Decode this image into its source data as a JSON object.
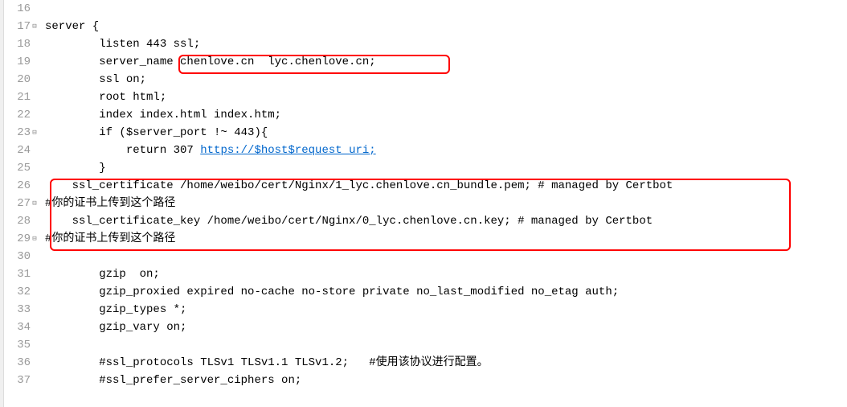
{
  "lines": [
    {
      "num": "16",
      "fold": "",
      "text": " "
    },
    {
      "num": "17",
      "fold": "⊟",
      "text": "server {"
    },
    {
      "num": "18",
      "fold": "",
      "text": "        listen 443 ssl;"
    },
    {
      "num": "19",
      "fold": "",
      "text": "        server_name chenlove.cn  lyc.chenlove.cn;"
    },
    {
      "num": "20",
      "fold": "",
      "text": "        ssl on;"
    },
    {
      "num": "21",
      "fold": "",
      "text": "        root html;"
    },
    {
      "num": "22",
      "fold": "",
      "text": "        index index.html index.htm;"
    },
    {
      "num": "23",
      "fold": "⊟",
      "text": "        if ($server_port !~ 443){"
    },
    {
      "num": "24",
      "fold": "",
      "text": "            return 307 ",
      "link": "https://$host$request_uri;"
    },
    {
      "num": "25",
      "fold": "",
      "text": "        }"
    },
    {
      "num": "26",
      "fold": "",
      "text": "    ssl_certificate /home/weibo/cert/Nginx/1_lyc.chenlove.cn_bundle.pem; # managed by Certbot"
    },
    {
      "num": "27",
      "fold": "⊟",
      "text": "#你的证书上传到这个路径"
    },
    {
      "num": "28",
      "fold": "",
      "text": "    ssl_certificate_key /home/weibo/cert/Nginx/0_lyc.chenlove.cn.key; # managed by Certbot"
    },
    {
      "num": "29",
      "fold": "⊟",
      "text": "#你的证书上传到这个路径"
    },
    {
      "num": "30",
      "fold": "",
      "text": " "
    },
    {
      "num": "31",
      "fold": "",
      "text": "        gzip  on;"
    },
    {
      "num": "32",
      "fold": "",
      "text": "        gzip_proxied expired no-cache no-store private no_last_modified no_etag auth;"
    },
    {
      "num": "33",
      "fold": "",
      "text": "        gzip_types *;"
    },
    {
      "num": "34",
      "fold": "",
      "text": "        gzip_vary on;"
    },
    {
      "num": "35",
      "fold": "",
      "text": " "
    },
    {
      "num": "36",
      "fold": "",
      "text": "        #ssl_protocols TLSv1 TLSv1.1 TLSv1.2;   #使用该协议进行配置。"
    },
    {
      "num": "37",
      "fold": "",
      "text": "        #ssl_prefer_server_ciphers on;"
    }
  ]
}
